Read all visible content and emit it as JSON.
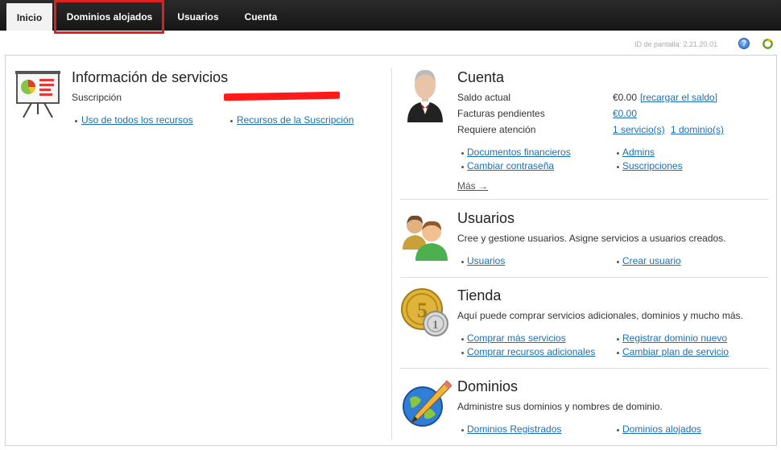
{
  "tabs": [
    {
      "label": "Inicio"
    },
    {
      "label": "Dominios alojados"
    },
    {
      "label": "Usuarios"
    },
    {
      "label": "Cuenta"
    }
  ],
  "screen_id": "ID de pantalla:  2.21.20.01",
  "help_label": "?",
  "services": {
    "title": "Información de servicios",
    "subscription_label": "Suscripción",
    "links": [
      "Uso de todos los recursos",
      "Recursos de la Suscripción"
    ]
  },
  "account": {
    "title": "Cuenta",
    "rows": [
      {
        "label": "Saldo actual",
        "value": "€0.00",
        "link": "[recargar el saldo]"
      },
      {
        "label": "Facturas pendientes",
        "link": "€0.00"
      },
      {
        "label": "Requiere atención",
        "link": "1 servicio(s)",
        "link2": "1 dominio(s)"
      }
    ],
    "links": [
      "Documentos financieros",
      "Admins",
      "Cambiar contraseña",
      "Suscripciones"
    ],
    "more": "Más →"
  },
  "users": {
    "title": "Usuarios",
    "desc": "Cree y gestione usuarios. Asigne servicios a usuarios creados.",
    "links": [
      "Usuarios",
      "Crear usuario"
    ]
  },
  "store": {
    "title": "Tienda",
    "desc": "Aquí puede comprar servicios adicionales, dominios y mucho más.",
    "links": [
      "Comprar más servicios",
      "Registrar dominio nuevo",
      "Comprar recursos adicionales",
      "Cambiar plan de servicio"
    ]
  },
  "domains": {
    "title": "Dominios",
    "desc": "Administre sus dominios y nombres de dominio.",
    "links": [
      "Dominios Registrados",
      "Dominios alojados"
    ]
  },
  "colors": {
    "link": "#1a6fb5",
    "highlight": "#e02020",
    "redaction": "#ff1a1a"
  }
}
